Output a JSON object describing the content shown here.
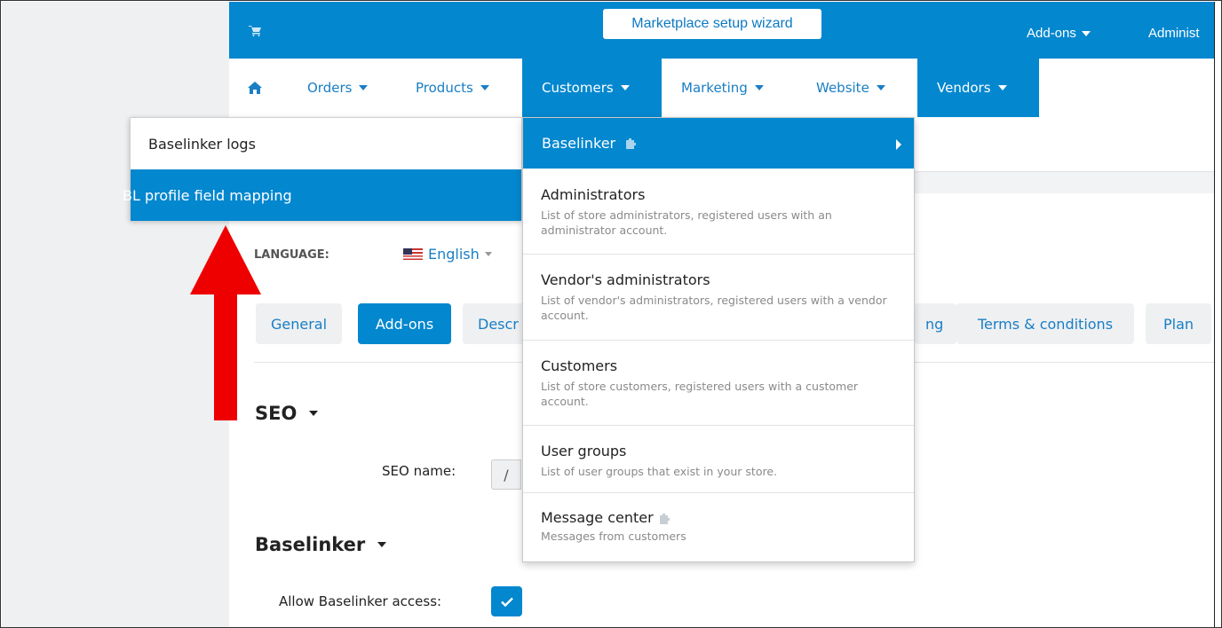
{
  "topbar": {
    "wizard_label": "Marketplace setup wizard",
    "addons_label": "Add-ons",
    "admin_label": "Administ"
  },
  "nav": {
    "items": [
      {
        "label": "Orders"
      },
      {
        "label": "Products"
      },
      {
        "label": "Customers"
      },
      {
        "label": "Marketing"
      },
      {
        "label": "Website"
      },
      {
        "label": "Vendors"
      }
    ]
  },
  "submenu_left": {
    "items": [
      {
        "label": "Baselinker logs"
      },
      {
        "label": "BL profile field mapping"
      }
    ]
  },
  "customers_dropdown": {
    "header": "Baselinker",
    "items": [
      {
        "title": "Administrators",
        "desc": "List of store administrators, registered users with an administrator account."
      },
      {
        "title": "Vendor's administrators",
        "desc": "List of vendor's administrators, registered users with a vendor account."
      },
      {
        "title": "Customers",
        "desc": "List of store customers, registered users with a customer account."
      },
      {
        "title": "User groups",
        "desc": "List of user groups that exist in your store."
      },
      {
        "title": "Message center",
        "desc": "Messages from customers"
      }
    ]
  },
  "page": {
    "language_label": "LANGUAGE:",
    "language_value": "English",
    "tabs": [
      {
        "label": "General"
      },
      {
        "label": "Add-ons"
      },
      {
        "label": "Descr"
      },
      {
        "label": "ng"
      },
      {
        "label": "Terms & conditions"
      },
      {
        "label": "Plan"
      }
    ],
    "seo_heading": "SEO",
    "seo_name_label": "SEO name:",
    "seo_prefix": "/",
    "baselinker_heading": "Baselinker",
    "allow_access_label": "Allow Baselinker access:"
  },
  "colors": {
    "primary": "#0387cf",
    "link": "#1a7ec4",
    "annotation_arrow": "#ee0000"
  }
}
